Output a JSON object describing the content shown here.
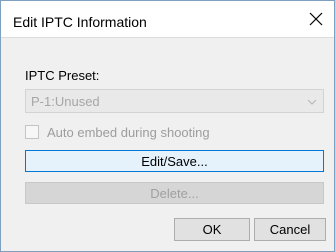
{
  "dialog": {
    "title": "Edit IPTC Information",
    "close_icon": "close-icon"
  },
  "preset": {
    "label": "IPTC Preset:",
    "selected": "P-1:Unused",
    "arrow_icon": "chevron-down-icon"
  },
  "auto_embed": {
    "label": "Auto embed during shooting",
    "checked": false
  },
  "buttons": {
    "edit_save": "Edit/Save...",
    "delete": "Delete...",
    "ok": "OK",
    "cancel": "Cancel"
  },
  "colors": {
    "accent": "#0078d7",
    "disabled_text": "#a0a0a0"
  }
}
